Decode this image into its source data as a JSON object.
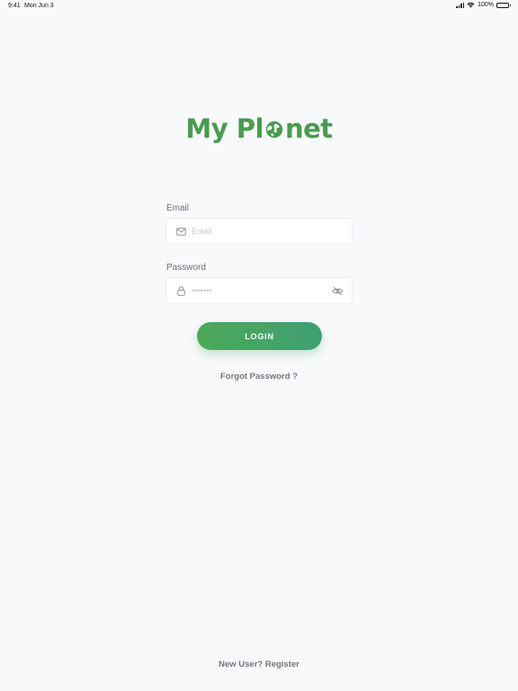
{
  "status_bar": {
    "time": "9:41",
    "date": "Mon Jun 3",
    "battery": "100%"
  },
  "logo": {
    "part1": "My Pl",
    "part2": "net",
    "color": "#4a9b4f"
  },
  "email": {
    "label": "Email",
    "placeholder": "Email",
    "icon": "mail-icon"
  },
  "password": {
    "label": "Password",
    "placeholder": "•••••••",
    "icon": "lock-icon",
    "toggle_icon": "eye-off-icon"
  },
  "login_button": {
    "label": "LOGIN",
    "colors": [
      "#4ca957",
      "#3f9f73"
    ]
  },
  "forgot_password": "Forgot Password ?",
  "register": "New User? Register"
}
